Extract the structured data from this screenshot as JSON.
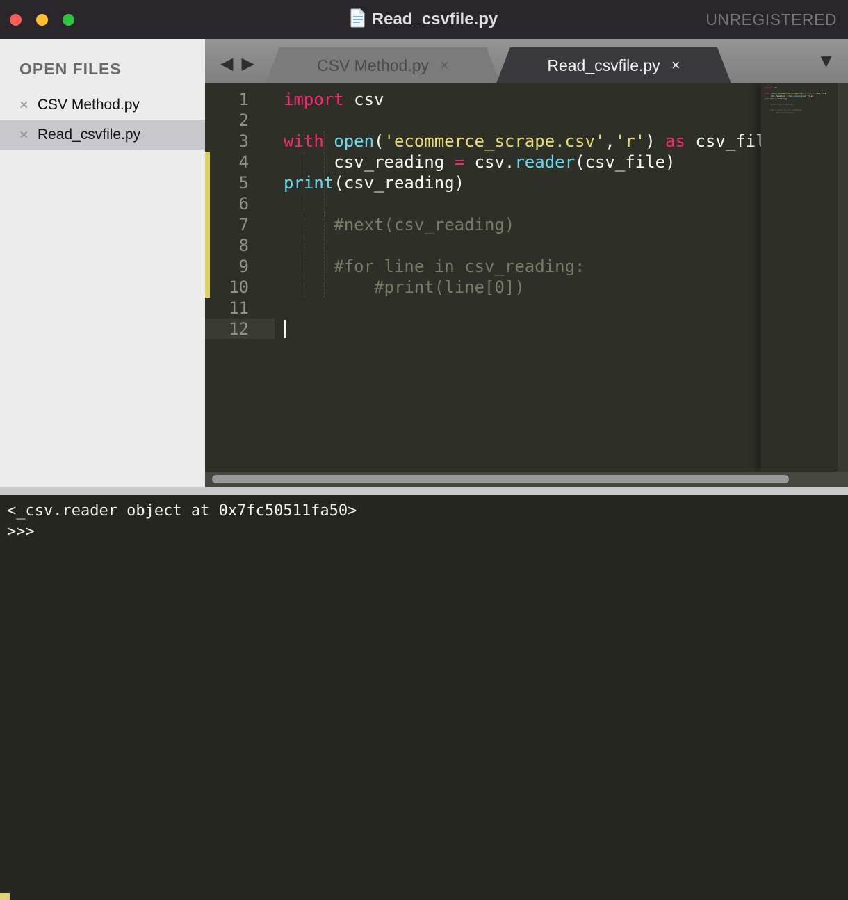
{
  "titlebar": {
    "title": "Read_csvfile.py",
    "registration": "UNREGISTERED"
  },
  "sidebar": {
    "header": "OPEN FILES",
    "close_glyph": "×",
    "files": [
      {
        "label": "CSV Method.py",
        "selected": false
      },
      {
        "label": "Read_csvfile.py",
        "selected": true
      }
    ]
  },
  "tabbar": {
    "nav_back_icon": "◀",
    "nav_forward_icon": "▶",
    "overflow_icon": "▼",
    "close_glyph": "×",
    "tabs": [
      {
        "label": "CSV Method.py",
        "active": false
      },
      {
        "label": "Read_csvfile.py",
        "active": true
      }
    ]
  },
  "editor": {
    "modified_lines": {
      "from": 4,
      "to": 10
    },
    "lines": [
      {
        "num": "1",
        "tokens": [
          {
            "t": "import",
            "c": "kw"
          },
          {
            "t": " csv",
            "c": "pl"
          }
        ]
      },
      {
        "num": "2",
        "tokens": []
      },
      {
        "num": "3",
        "tokens": [
          {
            "t": "with",
            "c": "kw"
          },
          {
            "t": " ",
            "c": "pl"
          },
          {
            "t": "open",
            "c": "fn"
          },
          {
            "t": "(",
            "c": "pl"
          },
          {
            "t": "'ecommerce_scrape.csv'",
            "c": "str"
          },
          {
            "t": ",",
            "c": "pl"
          },
          {
            "t": "'r'",
            "c": "str"
          },
          {
            "t": ") ",
            "c": "pl"
          },
          {
            "t": "as",
            "c": "kw"
          },
          {
            "t": " csv_file",
            "c": "pl"
          }
        ]
      },
      {
        "num": "4",
        "tokens": [
          {
            "t": "     csv_reading ",
            "c": "pl"
          },
          {
            "t": "=",
            "c": "kw"
          },
          {
            "t": " csv.",
            "c": "pl"
          },
          {
            "t": "reader",
            "c": "fn"
          },
          {
            "t": "(csv_file)",
            "c": "pl"
          }
        ]
      },
      {
        "num": "5",
        "tokens": [
          {
            "t": "print",
            "c": "fn"
          },
          {
            "t": "(csv_reading)",
            "c": "pl"
          }
        ]
      },
      {
        "num": "6",
        "tokens": []
      },
      {
        "num": "7",
        "tokens": [
          {
            "t": "     #next(csv_reading)",
            "c": "cm"
          }
        ]
      },
      {
        "num": "8",
        "tokens": []
      },
      {
        "num": "9",
        "tokens": [
          {
            "t": "     #for line in csv_reading:",
            "c": "cm"
          }
        ]
      },
      {
        "num": "10",
        "tokens": [
          {
            "t": "         #print(line[0])",
            "c": "cm"
          }
        ]
      },
      {
        "num": "11",
        "tokens": []
      },
      {
        "num": "12",
        "tokens": [],
        "current": true,
        "cursor": true
      }
    ]
  },
  "console": {
    "output": "<_csv.reader object at 0x7fc50511fa50>",
    "prompt": ">>>"
  },
  "colors": {
    "keyword": "#f92672",
    "function": "#66d9ef",
    "string": "#e6db74",
    "comment": "#787b66",
    "plain": "#f8f8f2",
    "modified_marker": "#dcd26c",
    "editor_bg": "#2e3027",
    "console_bg": "#24261f",
    "active_tab_bg": "#39383c"
  }
}
